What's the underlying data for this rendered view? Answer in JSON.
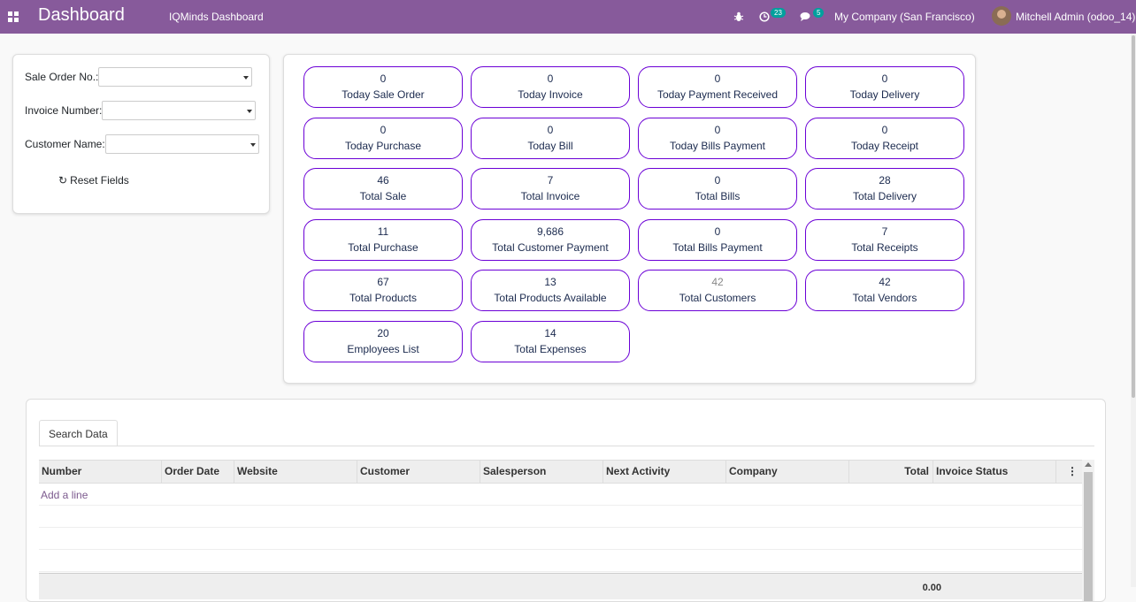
{
  "navbar": {
    "apps_icon": "apps-grid-icon",
    "brand": "Dashboard",
    "menu_item": "IQMinds Dashboard",
    "bug_icon": "bug-icon",
    "activity_badge": "23",
    "message_badge": "5",
    "company": "My Company (San Francisco)",
    "username": "Mitchell Admin (odoo_14)",
    "color": "#875A9B",
    "badge_color": "#00A09D"
  },
  "filters": {
    "sale_order_label": "Sale Order No.:",
    "invoice_label": "Invoice Number:",
    "customer_label": "Customer Name:",
    "sale_order_value": "",
    "invoice_value": "",
    "customer_value": "",
    "reset_label": "Reset Fields",
    "reset_icon": "refresh-icon"
  },
  "cards": [
    {
      "value": "0",
      "label": "Today Sale Order"
    },
    {
      "value": "0",
      "label": "Today Invoice"
    },
    {
      "value": "0",
      "label": "Today Payment Received"
    },
    {
      "value": "0",
      "label": "Today Delivery"
    },
    {
      "value": "0",
      "label": "Today Purchase"
    },
    {
      "value": "0",
      "label": "Today Bill"
    },
    {
      "value": "0",
      "label": "Today Bills Payment"
    },
    {
      "value": "0",
      "label": "Today Receipt"
    },
    {
      "value": "46",
      "label": "Total Sale"
    },
    {
      "value": "7",
      "label": "Total Invoice"
    },
    {
      "value": "0",
      "label": "Total Bills"
    },
    {
      "value": "28",
      "label": "Total Delivery"
    },
    {
      "value": "11",
      "label": "Total Purchase"
    },
    {
      "value": "9,686",
      "label": "Total Customer Payment"
    },
    {
      "value": "0",
      "label": "Total Bills Payment"
    },
    {
      "value": "7",
      "label": "Total Receipts"
    },
    {
      "value": "67",
      "label": "Total Products"
    },
    {
      "value": "13",
      "label": "Total Products Available"
    },
    {
      "value": "42",
      "label": "Total Customers"
    },
    {
      "value": "42",
      "label": "Total Vendors"
    },
    {
      "value": "20",
      "label": "Employees List"
    },
    {
      "value": "14",
      "label": "Total Expenses"
    }
  ],
  "card_border_color": "#6B00D6",
  "table": {
    "tab_label": "Search Data",
    "columns": [
      "Number",
      "Order Date",
      "Website",
      "Customer",
      "Salesperson",
      "Next Activity",
      "Company",
      "Total",
      "Invoice Status"
    ],
    "add_line": "Add a line",
    "footer_total": "0.00"
  }
}
